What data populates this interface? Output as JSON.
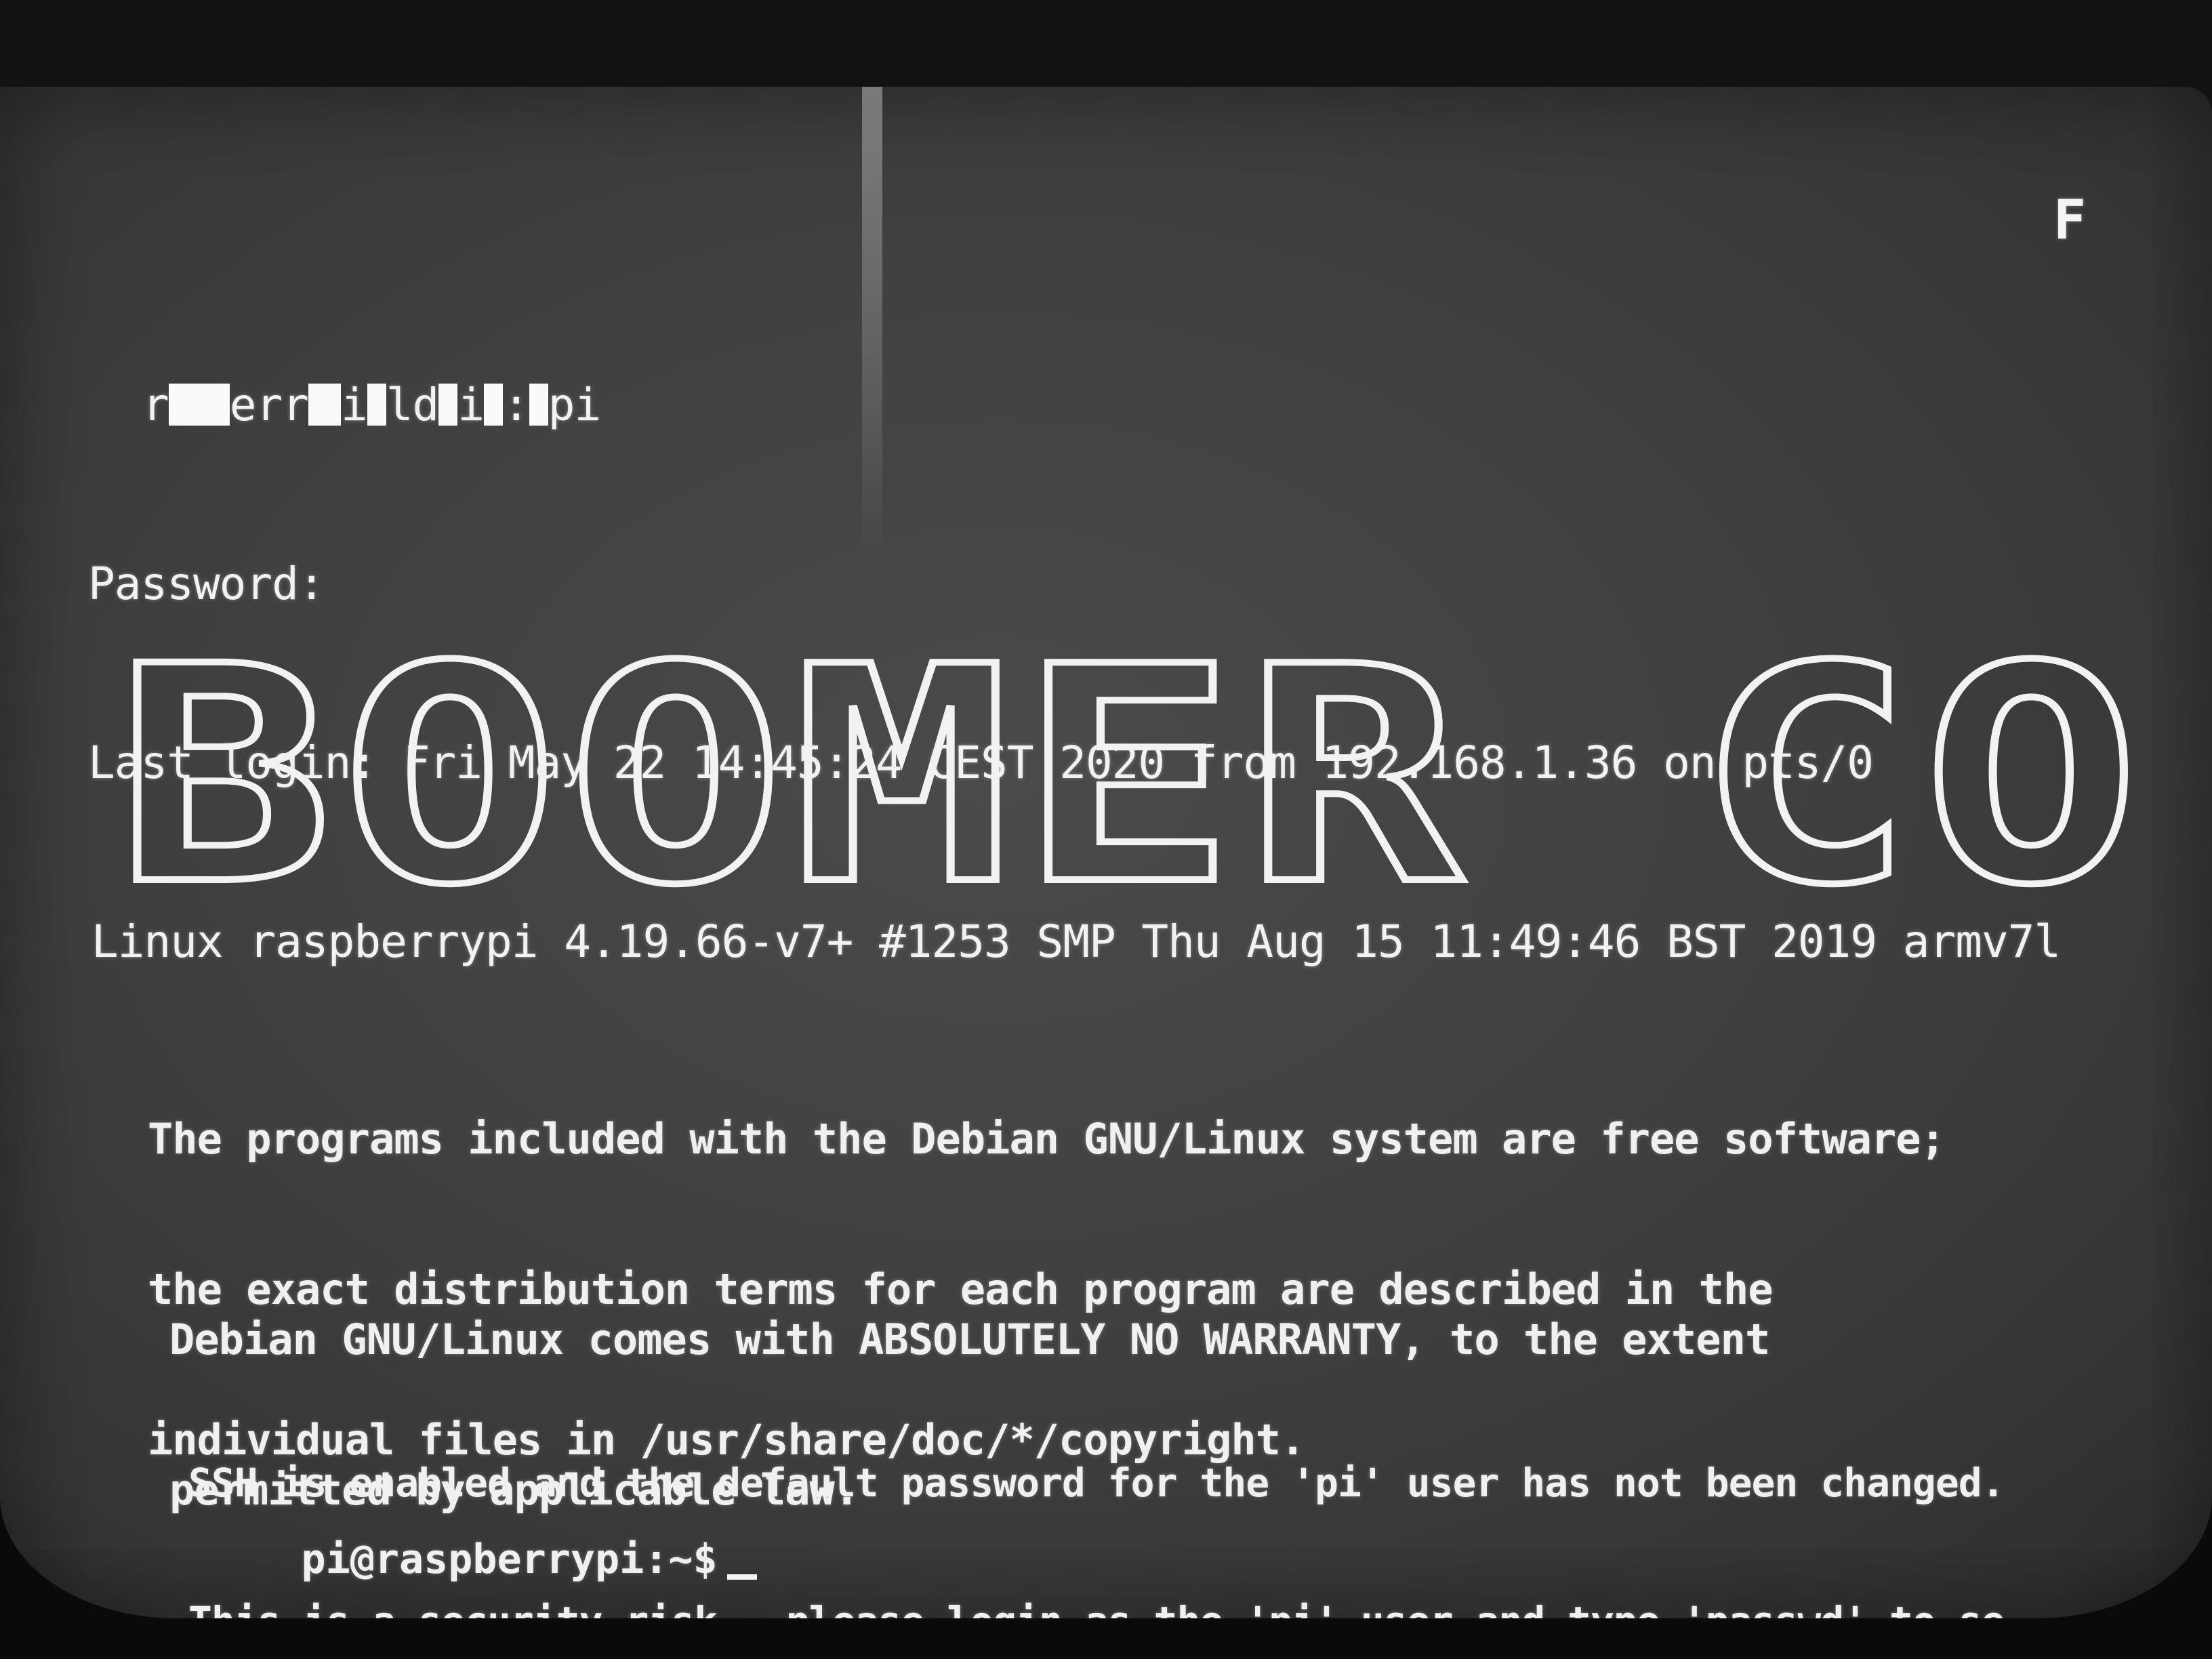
{
  "terminal": {
    "login_line_parts": [
      "r",
      "err",
      "i",
      "ld",
      "i",
      ":",
      "pi"
    ],
    "password_prompt": "Password:",
    "last_login": "Last login: Fri May 22 14:45:24 CEST 2020 from 192.168.1.36 on pts/0",
    "uname": "Linux raspberrypi 4.19.66-v7+ #1253 SMP Thu Aug 15 11:49:46 BST 2019 armv7l",
    "corner_marker": "F"
  },
  "banner": {
    "text": "BOOMER CO"
  },
  "motd": {
    "paragraph1": [
      "The programs included with the Debian GNU/Linux system are free software;",
      "the exact distribution terms for each program are described in the",
      "individual files in /usr/share/doc/*/copyright."
    ],
    "paragraph2": [
      "Debian GNU/Linux comes with ABSOLUTELY NO WARRANTY, to the extent",
      "permitted by applicable law."
    ],
    "paragraph3": [
      "SSH is enabled and the default password for the 'pi' user has not been changed.",
      "This is a security risk - please login as the 'pi' user and type 'passwd' to se"
    ]
  },
  "shell": {
    "prompt": "pi@raspberrypi:~$"
  },
  "colors": {
    "screen_bg": "#404040",
    "text": "#f2f2f2"
  }
}
